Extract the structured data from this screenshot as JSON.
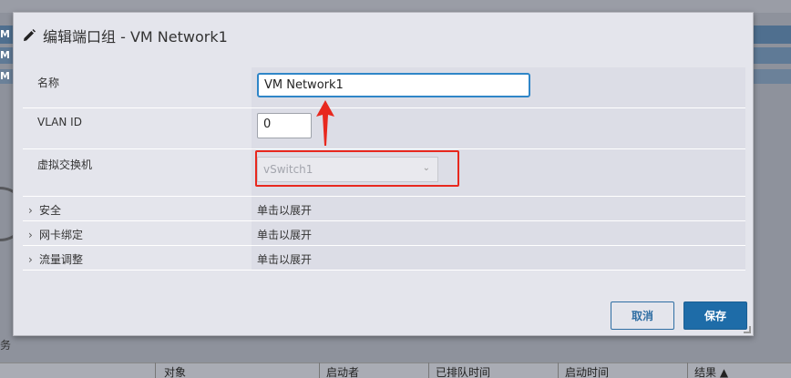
{
  "background": {
    "row_marks": [
      "M",
      "M",
      "M"
    ],
    "tasks_label": "务",
    "columns": [
      "对象",
      "启动者",
      "已排队时间",
      "启动时间",
      "结果 ▲"
    ]
  },
  "dialog": {
    "title": "编辑端口组 - VM Network1",
    "title_icon": "pencil-icon",
    "fields": {
      "name_label": "名称",
      "name_value": "VM Network1",
      "vlan_label": "VLAN ID",
      "vlan_value": "0",
      "vswitch_label": "虚拟交换机",
      "vswitch_value": "vSwitch1"
    },
    "sections": [
      {
        "label": "安全",
        "value": "单击以展开"
      },
      {
        "label": "网卡绑定",
        "value": "单击以展开"
      },
      {
        "label": "流量调整",
        "value": "单击以展开"
      }
    ],
    "buttons": {
      "cancel": "取消",
      "save": "保存"
    }
  },
  "annotations": {
    "highlight_color": "#e8281e"
  }
}
